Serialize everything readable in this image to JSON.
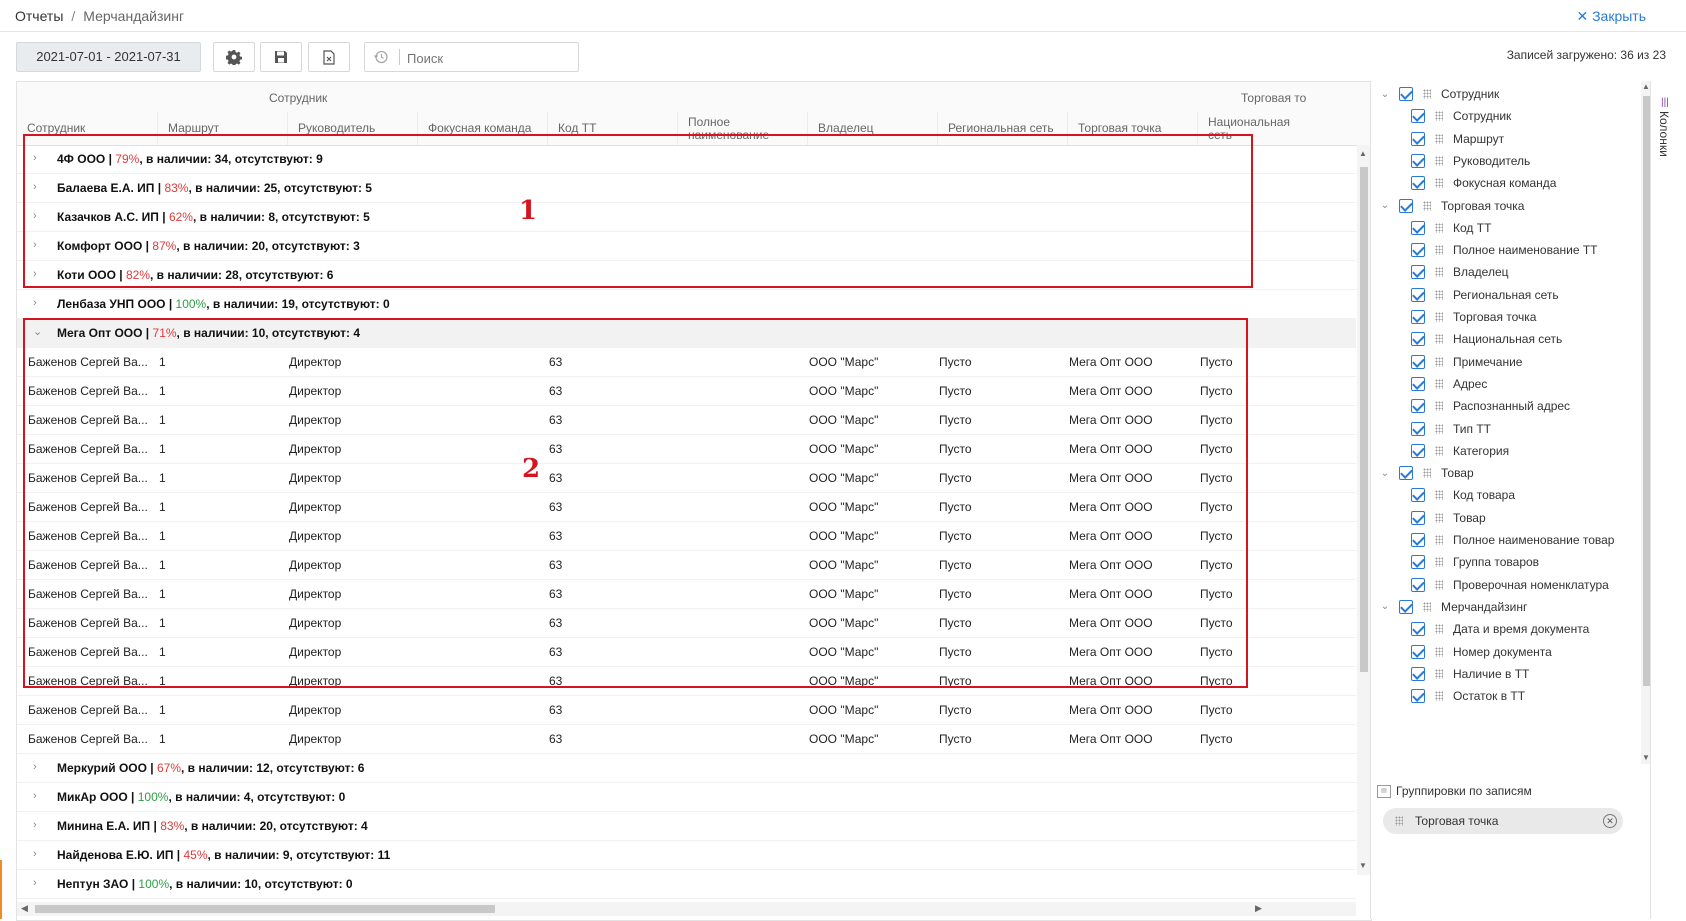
{
  "breadcrumb": {
    "root": "Отчеты",
    "separator": "/",
    "current": "Мерчандайзинг"
  },
  "close_label": "✕ Закрыть",
  "toolbar": {
    "date_range": "2021-07-01 - 2021-07-31",
    "search_placeholder": "Поиск"
  },
  "records_loaded": "Записей загружено: 36 из 23",
  "grid": {
    "group_headers": [
      "Сотрудник",
      "Торговая то"
    ],
    "columns": [
      "Сотрудник",
      "Маршрут",
      "Руководитель",
      "Фокусная команда",
      "Код ТТ",
      "Полное наименование",
      "Владелец",
      "Региональная сеть",
      "Торговая точка",
      "Национальная сеть"
    ],
    "groups_top": [
      {
        "name": "4Ф ООО |",
        "pct": "79%",
        "pct_color": "red",
        "rest": ", в наличии: 34, отсутствуют: 9"
      },
      {
        "name": "Балаева Е.А. ИП |",
        "pct": "83%",
        "pct_color": "red",
        "rest": ", в наличии: 25, отсутствуют: 5"
      },
      {
        "name": "Казачков А.С. ИП |",
        "pct": "62%",
        "pct_color": "red",
        "rest": ", в наличии: 8, отсутствуют: 5"
      },
      {
        "name": "Комфорт ООО |",
        "pct": "87%",
        "pct_color": "red",
        "rest": ", в наличии: 20, отсутствуют: 3"
      },
      {
        "name": "Коти ООО |",
        "pct": "82%",
        "pct_color": "red",
        "rest": ", в наличии: 28, отсутствуют: 6"
      },
      {
        "name": "Ленбаза УНП ООО |",
        "pct": "100%",
        "pct_color": "green",
        "rest": ", в наличии: 19, отсутствуют: 0"
      }
    ],
    "expanded_group": {
      "name": "Мега Опт ООО |",
      "pct": "71%",
      "pct_color": "red",
      "rest": ", в наличии: 10, отсутствуют: 4"
    },
    "detail_row": {
      "employee": "Баженов Сергей Ва...",
      "route": "1",
      "manager": "Директор",
      "code": "63",
      "owner": "ООО \"Марс\"",
      "regional": "Пусто",
      "point": "Мега Опт ООО",
      "national": "Пусто"
    },
    "detail_row_count": 14,
    "groups_bottom": [
      {
        "name": "Меркурий ООО |",
        "pct": "67%",
        "pct_color": "red",
        "rest": ", в наличии: 12, отсутствуют: 6"
      },
      {
        "name": "МикАр ООО |",
        "pct": "100%",
        "pct_color": "green",
        "rest": ", в наличии: 4, отсутствуют: 0"
      },
      {
        "name": "Минина Е.А. ИП |",
        "pct": "83%",
        "pct_color": "red",
        "rest": ", в наличии: 20, отсутствуют: 4"
      },
      {
        "name": "Найденова Е.Ю. ИП |",
        "pct": "45%",
        "pct_color": "red",
        "rest": ", в наличии: 9, отсутствуют: 11"
      },
      {
        "name": "Нептун ЗАО |",
        "pct": "100%",
        "pct_color": "green",
        "rest": ", в наличии: 10, отсутствуют: 0"
      }
    ],
    "annotations": [
      "1",
      "2"
    ]
  },
  "column_tree": [
    {
      "label": "Сотрудник",
      "level": 0
    },
    {
      "label": "Сотрудник",
      "level": 1
    },
    {
      "label": "Маршрут",
      "level": 1
    },
    {
      "label": "Руководитель",
      "level": 1
    },
    {
      "label": "Фокусная команда",
      "level": 1
    },
    {
      "label": "Торговая точка",
      "level": 0
    },
    {
      "label": "Код ТТ",
      "level": 1
    },
    {
      "label": "Полное наименование ТТ",
      "level": 1
    },
    {
      "label": "Владелец",
      "level": 1
    },
    {
      "label": "Региональная сеть",
      "level": 1
    },
    {
      "label": "Торговая точка",
      "level": 1
    },
    {
      "label": "Национальная сеть",
      "level": 1
    },
    {
      "label": "Примечание",
      "level": 1
    },
    {
      "label": "Адрес",
      "level": 1
    },
    {
      "label": "Распознанный адрес",
      "level": 1
    },
    {
      "label": "Тип ТТ",
      "level": 1
    },
    {
      "label": "Категория",
      "level": 1
    },
    {
      "label": "Товар",
      "level": 0
    },
    {
      "label": "Код товара",
      "level": 1
    },
    {
      "label": "Товар",
      "level": 1
    },
    {
      "label": "Полное наименование товар",
      "level": 1
    },
    {
      "label": "Группа товаров",
      "level": 1
    },
    {
      "label": "Проверочная номенклатура",
      "level": 1
    },
    {
      "label": "Мерчандайзинг",
      "level": 0
    },
    {
      "label": "Дата и время документа",
      "level": 1
    },
    {
      "label": "Номер документа",
      "level": 1
    },
    {
      "label": "Наличие в ТТ",
      "level": 1
    },
    {
      "label": "Остаток в ТТ",
      "level": 1
    }
  ],
  "grouping": {
    "title": "Группировки по записям",
    "chip": "Торговая точка"
  },
  "side_tab_label": "Колонки",
  "colors": {
    "accent": "#2a7ad5",
    "annotation_red": "#d4141e",
    "pct_red": "#e03a3a",
    "pct_green": "#2e9e45"
  }
}
